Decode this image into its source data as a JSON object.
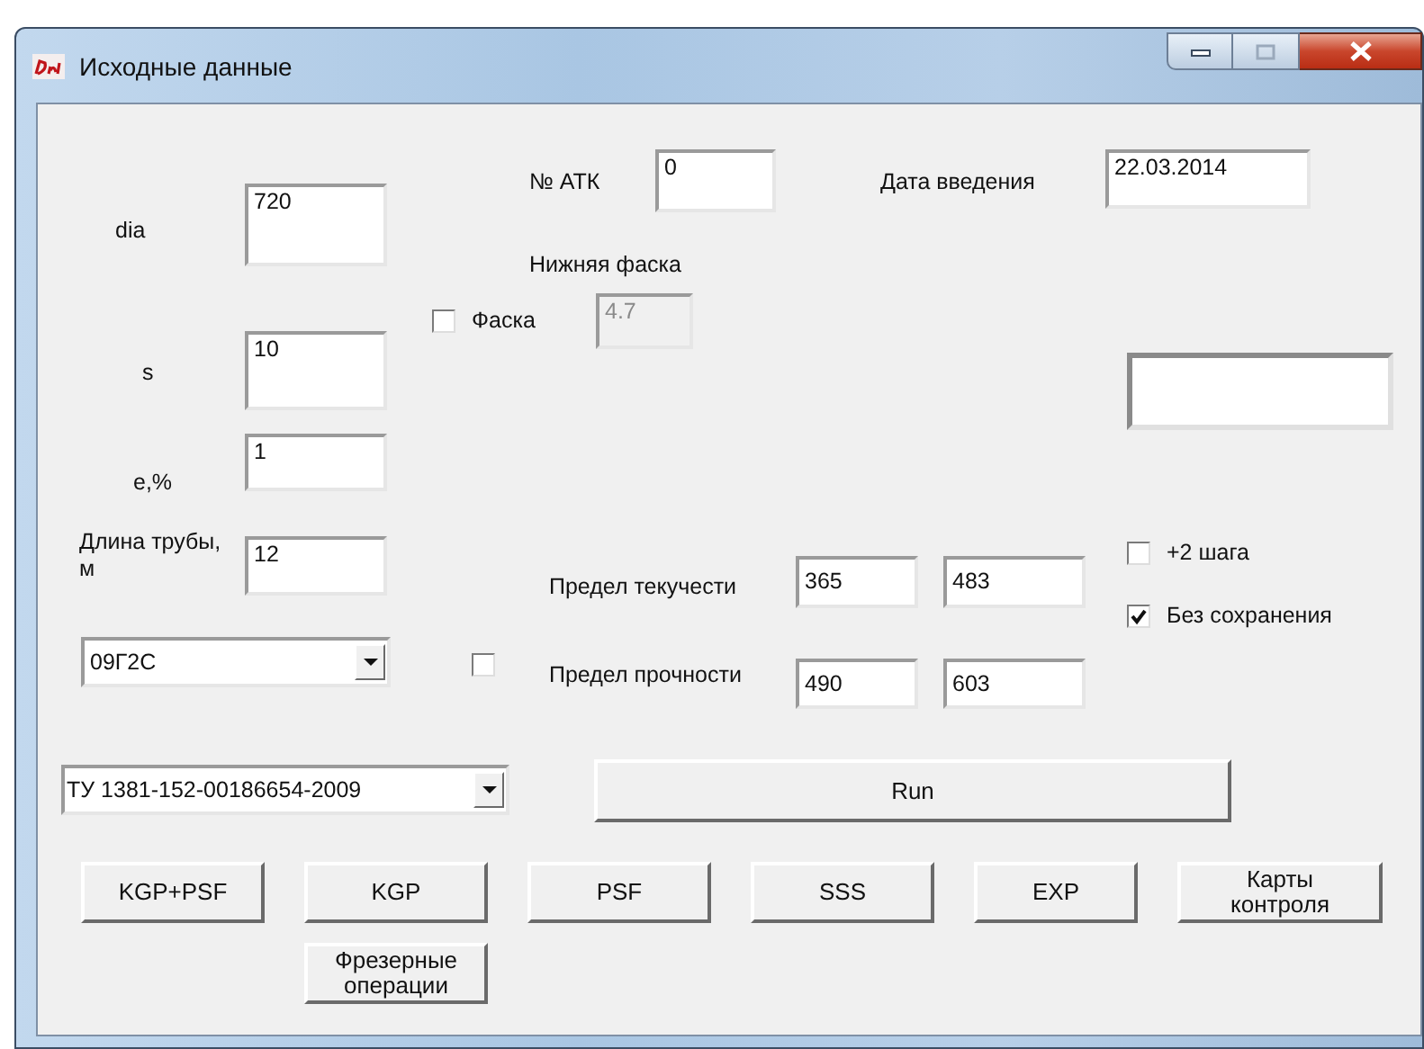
{
  "window": {
    "title": "Исходные данные"
  },
  "labels": [
    "dia",
    "s",
    "e,%",
    "Длина трубы, м",
    "№ АТК",
    "Дата введения",
    "Нижняя фаска",
    "Предел текучести",
    "Предел прочности"
  ],
  "fields": [
    {
      "value": "720",
      "disabled": false
    },
    {
      "value": "0",
      "disabled": false
    },
    {
      "value": "22.03.2014",
      "disabled": false
    },
    {
      "value": "4.7",
      "disabled": true
    },
    {
      "value": "10",
      "disabled": false
    },
    {
      "value": "1",
      "disabled": false
    },
    {
      "disabled": false
    },
    {
      "value": "12",
      "disabled": false
    },
    {
      "value": "365",
      "disabled": false
    },
    {
      "value": "483",
      "disabled": false
    },
    {
      "value": "490",
      "disabled": false
    },
    {
      "value": "603",
      "disabled": false
    }
  ],
  "checkboxes": [
    {
      "label": "Фаска",
      "checked": false
    },
    {
      "label": "+2 шага",
      "checked": false
    },
    {
      "label": "Без сохранения",
      "checked": true
    },
    {
      "checked": false
    }
  ],
  "comboboxes": [
    {
      "value": "09Г2С"
    },
    {
      "value": "ТУ 1381-152-00186654-2009"
    }
  ],
  "buttons": [
    {
      "label": "Run"
    },
    {
      "label": "KGP+PSF"
    },
    {
      "label": "KGP"
    },
    {
      "label": "PSF"
    },
    {
      "label": "SSS"
    },
    {
      "label": "EXP"
    },
    {
      "label": "Карты контроля"
    },
    {
      "label": "Фрезерные операции"
    }
  ]
}
